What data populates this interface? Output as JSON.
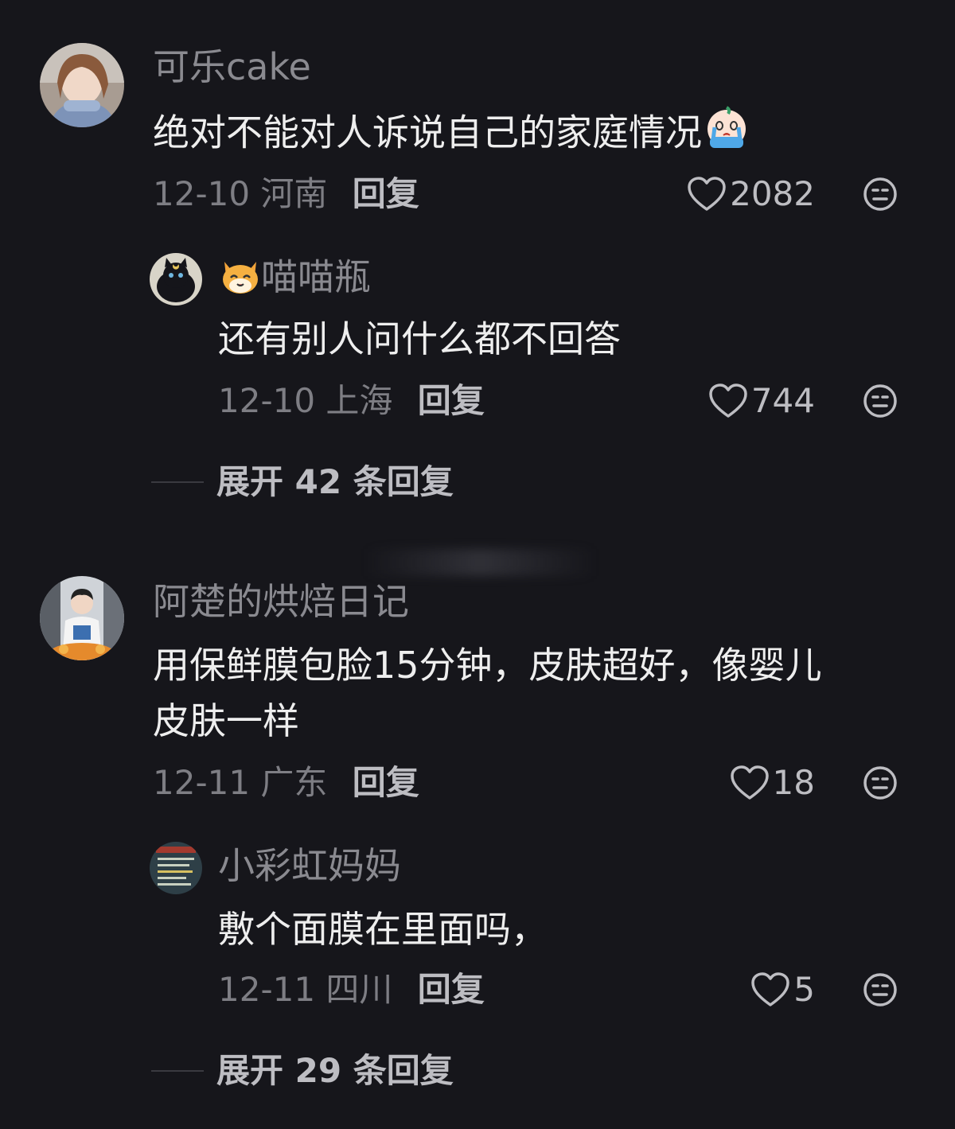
{
  "comments": [
    {
      "username": "可乐cake",
      "text": "绝对不能对人诉说自己的家庭情况",
      "date": "12-10",
      "location": "河南",
      "reply_label": "回复",
      "likes": "2082"
    },
    {
      "username": "喵喵瓶",
      "text": "还有别人问什么都不回答",
      "date": "12-10",
      "location": "上海",
      "reply_label": "回复",
      "likes": "744"
    },
    {
      "username": "阿楚的烘焙日记",
      "text_line1": "用保鲜膜包脸15分钟，皮肤超好，像婴儿",
      "text_line2": "皮肤一样",
      "date": "12-11",
      "location": "广东",
      "reply_label": "回复",
      "likes": "18"
    },
    {
      "username": "小彩虹妈妈",
      "text": "敷个面膜在里面吗，",
      "date": "12-11",
      "location": "四川",
      "reply_label": "回复",
      "likes": "5"
    }
  ],
  "expand_1": "展开 42 条回复",
  "expand_2": "展开 29 条回复",
  "icons": {
    "like": "heart-outline-icon",
    "dislike": "meh-face-icon",
    "emoji_cry": "crying-face-emoji",
    "emoji_cat": "cat-face-emoji"
  }
}
